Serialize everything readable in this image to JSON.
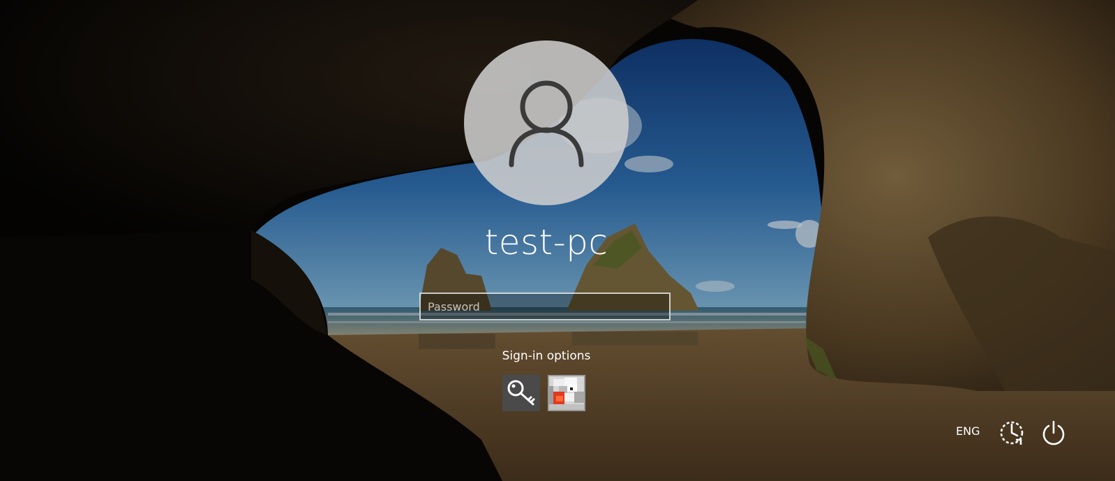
{
  "user": {
    "name": "test-pc"
  },
  "password": {
    "placeholder": "Password"
  },
  "signin": {
    "label": "Sign-in options",
    "options": [
      {
        "icon": "key-icon"
      },
      {
        "icon": "picture-password-icon"
      }
    ]
  },
  "tray": {
    "language": "ENG",
    "icons": [
      "ease-of-access-icon",
      "power-icon"
    ]
  },
  "colors": {
    "text": "#ffffff",
    "avatar_bg": "#cdcdcd",
    "avatar_glyph": "#3a3a3a",
    "key_option_bg": "#4a4a4a",
    "sky": "#2f6fb0",
    "rock": "#6b5535",
    "sand": "#8a6a42"
  }
}
